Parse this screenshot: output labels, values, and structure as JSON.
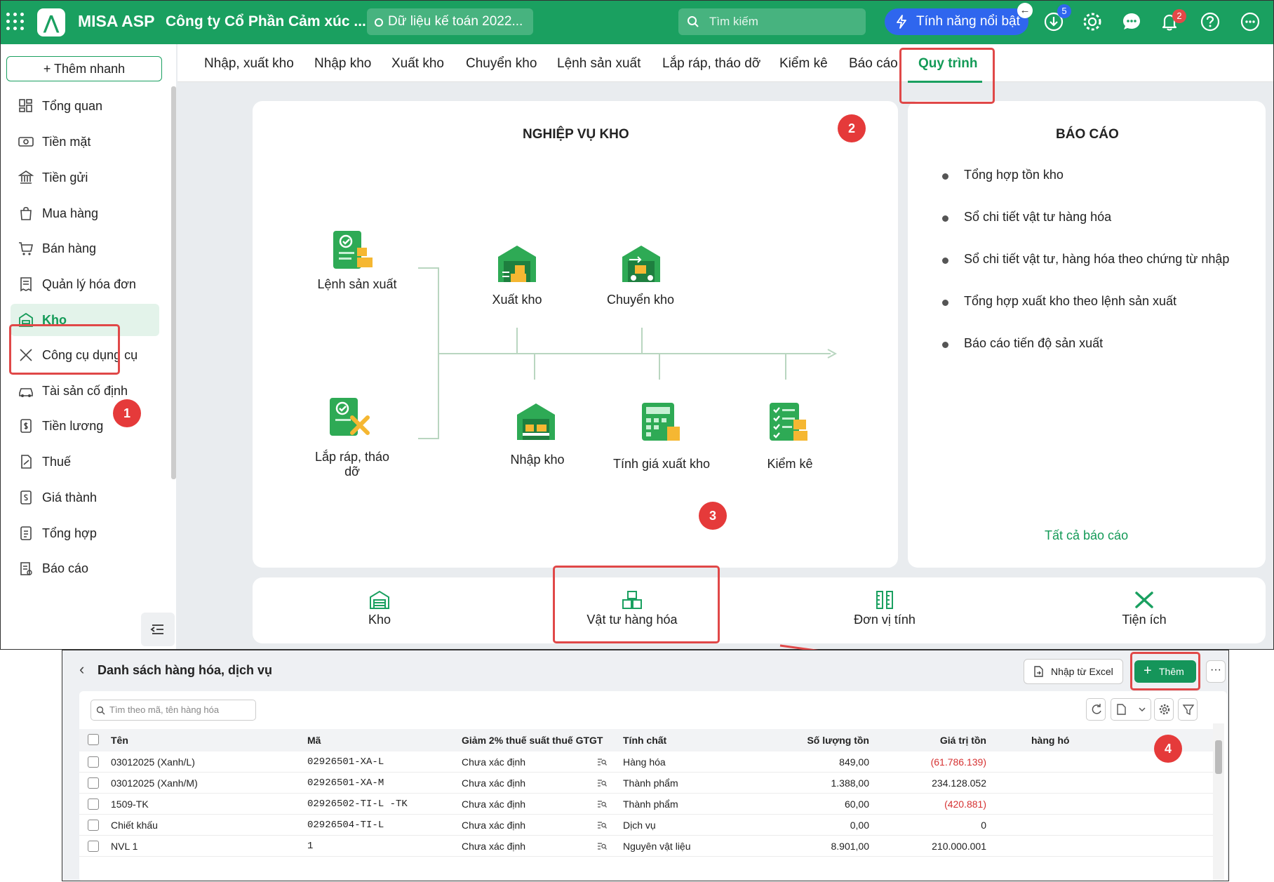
{
  "topbar": {
    "app_name": "MISA ASP",
    "company": "Công ty Cổ Phần Cảm xúc ...",
    "dataset": "Dữ liệu kế toán 2022...",
    "search_placeholder": "Tìm kiếm",
    "feature_label": "Tính năng nổi bật",
    "download_badge": "5",
    "notification_badge": "2",
    "brand_color": "#1aa060"
  },
  "sidebar": {
    "quick_add": "+ Thêm nhanh",
    "items": [
      {
        "label": "Tổng quan",
        "icon": "dashboard-icon"
      },
      {
        "label": "Tiền mặt",
        "icon": "cash-icon"
      },
      {
        "label": "Tiền gửi",
        "icon": "bank-icon"
      },
      {
        "label": "Mua hàng",
        "icon": "shopping-bag-icon"
      },
      {
        "label": "Bán hàng",
        "icon": "cart-icon"
      },
      {
        "label": "Quản lý hóa đơn",
        "icon": "invoice-icon"
      },
      {
        "label": "Kho",
        "icon": "warehouse-icon",
        "active": true
      },
      {
        "label": "Công cụ dụng cụ",
        "icon": "tools-icon"
      },
      {
        "label": "Tài sản cố định",
        "icon": "car-icon"
      },
      {
        "label": "Tiền lương",
        "icon": "salary-icon"
      },
      {
        "label": "Thuế",
        "icon": "tax-icon"
      },
      {
        "label": "Giá thành",
        "icon": "cost-icon"
      },
      {
        "label": "Tổng hợp",
        "icon": "summary-icon"
      },
      {
        "label": "Báo cáo",
        "icon": "report-icon"
      }
    ]
  },
  "tabs": [
    {
      "label": "Nhập, xuất kho"
    },
    {
      "label": "Nhập kho"
    },
    {
      "label": "Xuất kho"
    },
    {
      "label": "Chuyển kho"
    },
    {
      "label": "Lệnh sản xuất"
    },
    {
      "label": "Lắp ráp, tháo dỡ"
    },
    {
      "label": "Kiểm kê"
    },
    {
      "label": "Báo cáo"
    },
    {
      "label": "Quy trình",
      "active": true
    }
  ],
  "process": {
    "title": "NGHIỆP VỤ KHO",
    "nodes": {
      "production_order": "Lệnh sản xuất",
      "assembly": "Lắp ráp, tháo dỡ",
      "stock_out": "Xuất kho",
      "transfer": "Chuyển kho",
      "stock_in": "Nhập kho",
      "pricing": "Tính giá xuất kho",
      "inventory_check": "Kiểm kê"
    }
  },
  "reports": {
    "title": "BÁO CÁO",
    "items": [
      "Tổng hợp tồn kho",
      "Sổ chi tiết vật tư hàng hóa",
      "Sổ chi tiết vật tư, hàng hóa theo chứng từ nhập",
      "Tổng hợp xuất kho theo lệnh sản xuất",
      "Báo cáo tiến độ sản xuất"
    ],
    "all_link": "Tất cả báo cáo"
  },
  "categories": [
    {
      "label": "Kho"
    },
    {
      "label": "Vật tư hàng hóa"
    },
    {
      "label": "Đơn vị tính"
    },
    {
      "label": "Tiện ích"
    }
  ],
  "steps": [
    "1",
    "2",
    "3",
    "4"
  ],
  "list": {
    "title": "Danh sách hàng hóa, dịch vụ",
    "import_excel": "Nhập từ Excel",
    "add": "Thêm",
    "search_placeholder": "Tìm theo mã, tên hàng hóa",
    "columns": [
      "Tên",
      "Mã",
      "Giảm 2% thuế suất thuế GTGT",
      "Tính chất",
      "Số lượng tồn",
      "Giá trị tồn",
      "hàng hó"
    ],
    "rows": [
      {
        "name": "03012025 (Xanh/L)",
        "code": "02926501-XA-L",
        "vat": "Chưa xác định",
        "nature": "Hàng hóa",
        "qty": "849,00",
        "value": "(61.786.139)",
        "negative": true
      },
      {
        "name": "03012025 (Xanh/M)",
        "code": "02926501-XA-M",
        "vat": "Chưa xác định",
        "nature": "Thành phẩm",
        "qty": "1.388,00",
        "value": "234.128.052",
        "negative": false
      },
      {
        "name": "1509-TK",
        "code": "02926502-TI-L -TK",
        "vat": "Chưa xác định",
        "nature": "Thành phẩm",
        "qty": "60,00",
        "value": "(420.881)",
        "negative": true
      },
      {
        "name": "Chiết khấu",
        "code": "02926504-TI-L",
        "vat": "Chưa xác định",
        "nature": "Dịch vụ",
        "qty": "0,00",
        "value": "0",
        "negative": false
      },
      {
        "name": "NVL 1",
        "code": "1",
        "vat": "Chưa xác định",
        "nature": "Nguyên vật liệu",
        "qty": "8.901,00",
        "value": "210.000.001",
        "negative": false
      }
    ]
  }
}
